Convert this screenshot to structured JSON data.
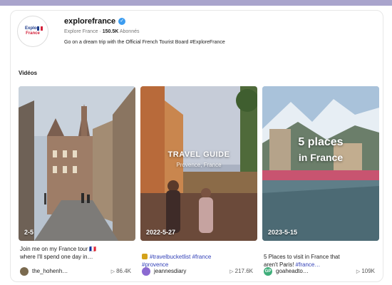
{
  "profile": {
    "handle": "explorefrance",
    "display_name": "Explore France",
    "followers_count": "150.5K",
    "followers_label": "Abonnés",
    "bio": "Go on a dream trip with the Official French Tourist Board #ExploreFrance",
    "logo_line1": "Explore",
    "logo_line2": "France",
    "verified_icon": "verified-check-icon"
  },
  "section": {
    "title": "Vidéos"
  },
  "videos": [
    {
      "date": "2-5",
      "caption": "Join me on my France tour 🇫🇷\nwhere I'll spend one day in…",
      "author": "the_hohenh…",
      "views": "86.4K",
      "overlay_line1": "",
      "overlay_line2": "",
      "avatar_color": "#7a6a4f"
    },
    {
      "date": "2022-5-27",
      "caption_line1": "#travelbucketlist #france",
      "caption_line2": "#provence",
      "author": "jeannesdiary",
      "views": "217.6K",
      "overlay_line1": "TRAVEL GUIDE",
      "overlay_line2": "Provence, France",
      "avatar_color": "#8b6ad1"
    },
    {
      "date": "2023-5-15",
      "caption_line1": "5 Places to visit in France that",
      "caption_line2": "aren't Paris!",
      "caption_tag": "#france…",
      "author": "goaheadto…",
      "views": "109K",
      "overlay_line1": "5 places",
      "overlay_line2": "in France",
      "avatar_color": "#3fae7a",
      "avatar_text": "GP"
    }
  ],
  "colors": {
    "accent": "#3442b8",
    "verified": "#3b9cf0",
    "topbar": "#a9a4cc"
  }
}
